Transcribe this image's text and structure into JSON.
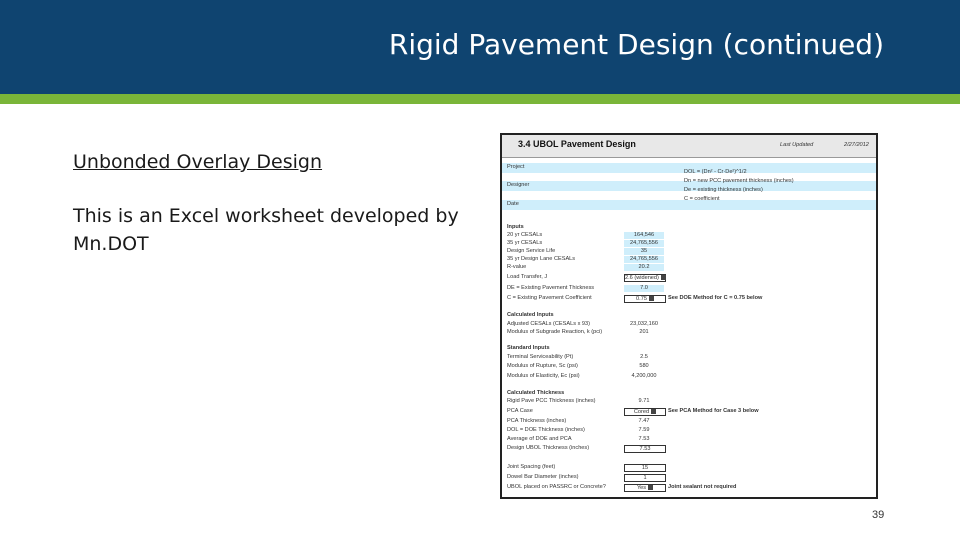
{
  "slide": {
    "title": "Rigid Pavement Design (continued)",
    "subheading": "Unbonded Overlay Design",
    "body": "This is an Excel worksheet developed by Mn.DOT",
    "page_number": "39",
    "colors": {
      "header": "#0f4470",
      "accent": "#7ab539"
    }
  },
  "sheet": {
    "title": "3.4 UBOL Pavement Design",
    "last_updated_label": "Last Updated",
    "last_updated_value": "2/27/2012",
    "project_label": "Project",
    "designer_label": "Designer",
    "date_label": "Date",
    "equations": [
      "DOL = (Dn² - Cr·De²)^1/2",
      "Dn = new PCC pavement thickness (inches)",
      "De = existing thickness (inches)",
      "C = coefficient"
    ],
    "inputs_header": "Inputs",
    "inputs": [
      {
        "label": "20 yr CESALs",
        "value": "164,546"
      },
      {
        "label": "35 yr CESALs",
        "value": "24,765,556"
      },
      {
        "label": "Design Service Life",
        "value": "35"
      },
      {
        "label": "35 yr Design Lane CESALs",
        "value": "24,765,556"
      },
      {
        "label": "R-value",
        "value": "20.2"
      },
      {
        "label": "Load Transfer, J",
        "value": "2.6 (widened)"
      },
      {
        "label": "DE = Existing Pavement Thickness",
        "value": "7.0"
      },
      {
        "label": "C = Existing Pavement Coefficient",
        "value": "0.75"
      }
    ],
    "inputs_note": "See DOE Method for C = 0.75 below",
    "calc_inputs_header": "Calculated Inputs",
    "calc_inputs": [
      {
        "label": "Adjusted CESALs (CESALs x 93)",
        "value": "23,032,160"
      },
      {
        "label": "Modulus of Subgrade Reaction, k (pci)",
        "value": "201"
      }
    ],
    "std_inputs_header": "Standard Inputs",
    "std_inputs": [
      {
        "label": "Terminal Serviceability (Pt)",
        "value": "2.5"
      },
      {
        "label": "Modulus of Rupture, Sc (psi)",
        "value": "580"
      },
      {
        "label": "Modulus of Elasticity, Ec (psi)",
        "value": "4,200,000"
      }
    ],
    "calc_thick_header": "Calculated Thickness",
    "calc_thick": [
      {
        "label": "Rigid Pave PCC Thickness (inches)",
        "value": "9.71"
      },
      {
        "label": "PCA Case",
        "value": "Cored"
      },
      {
        "label": "PCA Thickness (inches)",
        "value": "7.47"
      },
      {
        "label": "DOL = DOE Thickness (inches)",
        "value": "7.59"
      },
      {
        "label": "Average of DOE and PCA",
        "value": "7.53"
      },
      {
        "label": "Design UBOL Thickness (inches)",
        "value": "7.53"
      }
    ],
    "calc_thick_note": "See PCA Method for Case 3 below",
    "bottom": [
      {
        "label": "Joint Spacing (feet)",
        "value": "15"
      },
      {
        "label": "Dowel Bar Diameter (inches)",
        "value": "1"
      },
      {
        "label": "UBOL placed on PASSRC or Concrete?",
        "value": "Yes"
      }
    ],
    "bottom_note": "Joint sealant not required"
  }
}
